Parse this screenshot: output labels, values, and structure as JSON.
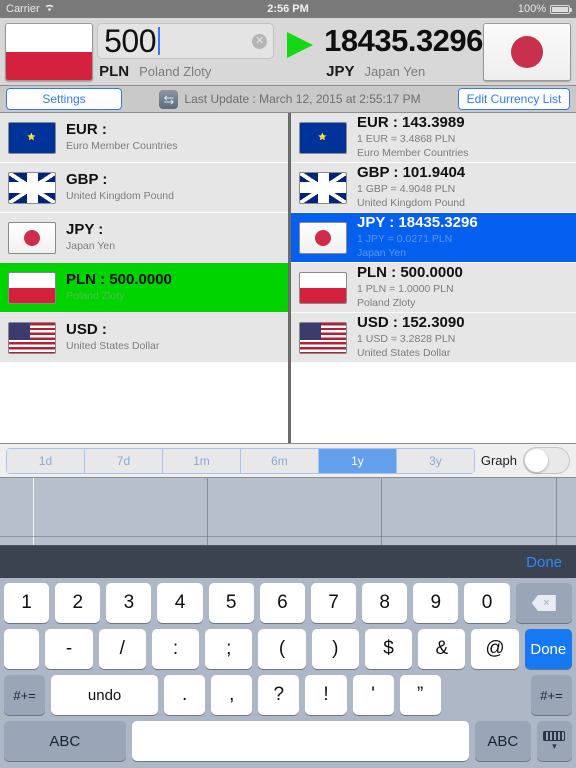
{
  "statusbar": {
    "carrier": "Carrier",
    "wifi_icon": "wifi-icon",
    "time": "2:56 PM",
    "battery_percent": "100%",
    "battery_icon": "battery-full-icon"
  },
  "header": {
    "source": {
      "flag_icon": "flag-poland-icon",
      "amount": "500",
      "code": "PLN",
      "name": "Poland Zloty",
      "clear_icon": "clear-icon"
    },
    "convert_icon": "play-triangle-icon",
    "target": {
      "result": "18435.3296",
      "code": "JPY",
      "name": "Japan Yen",
      "flag_icon": "flag-japan-icon"
    }
  },
  "toolbar": {
    "settings_label": "Settings",
    "refresh_icon": "refresh-icon",
    "last_update": "Last Update : March 12, 2015 at 2:55:17 PM",
    "edit_list_label": "Edit Currency List"
  },
  "left_list": [
    {
      "flag_icon": "flag-eu-icon",
      "flag_class": "f-eur",
      "title": "EUR :",
      "name": "Euro Member Countries",
      "state": ""
    },
    {
      "flag_icon": "flag-uk-icon",
      "flag_class": "f-gbp",
      "title": "GBP :",
      "name": "United Kingdom Pound",
      "state": ""
    },
    {
      "flag_icon": "flag-japan-icon",
      "flag_class": "f-jp",
      "title": "JPY :",
      "name": "Japan Yen",
      "state": ""
    },
    {
      "flag_icon": "flag-poland-icon",
      "flag_class": "f-pl",
      "title": "PLN : 500.0000",
      "name": "Poland Zloty",
      "state": "selected-green"
    },
    {
      "flag_icon": "flag-usa-icon",
      "flag_class": "f-usd",
      "title": "USD :",
      "name": "United States Dollar",
      "state": ""
    }
  ],
  "right_list": [
    {
      "flag_icon": "flag-eu-icon",
      "flag_class": "f-eur",
      "title": "EUR : 143.3989",
      "rate": "1 EUR = 3.4868 PLN",
      "name": "Euro Member Countries",
      "state": ""
    },
    {
      "flag_icon": "flag-uk-icon",
      "flag_class": "f-gbp",
      "title": "GBP : 101.9404",
      "rate": "1 GBP = 4.9048 PLN",
      "name": "United Kingdom Pound",
      "state": ""
    },
    {
      "flag_icon": "flag-japan-icon",
      "flag_class": "f-jp",
      "title": "JPY : 18435.3296",
      "rate": "1 JPY = 0.0271 PLN",
      "name": "Japan Yen",
      "state": "selected-blue"
    },
    {
      "flag_icon": "flag-poland-icon",
      "flag_class": "f-pl",
      "title": "PLN : 500.0000",
      "rate": "1 PLN = 1.0000 PLN",
      "name": "Poland Zloty",
      "state": ""
    },
    {
      "flag_icon": "flag-usa-icon",
      "flag_class": "f-usd",
      "title": "USD : 152.3090",
      "rate": "1 USD = 3.2828 PLN",
      "name": "United States Dollar",
      "state": ""
    }
  ],
  "range_selector": {
    "options": [
      "1d",
      "7d",
      "1m",
      "6m",
      "1y",
      "3y"
    ],
    "selected": "1y",
    "graph_label": "Graph",
    "graph_toggle_on": false
  },
  "keyboard": {
    "done_top_label": "Done",
    "row1": [
      "1",
      "2",
      "3",
      "4",
      "5",
      "6",
      "7",
      "8",
      "9",
      "0"
    ],
    "backspace_icon": "backspace-icon",
    "row2": [
      "-",
      "/",
      ":",
      ";",
      "(",
      ")",
      "$",
      "&",
      "@"
    ],
    "row2_done_label": "Done",
    "row3_left_label": "#+=",
    "row3_undo_label": "undo",
    "row3": [
      ".",
      ",",
      "?",
      "!",
      "'",
      "”"
    ],
    "row3_right_label": "#+=",
    "row4_abc_left": "ABC",
    "row4_space": "",
    "row4_abc_right": "ABC",
    "hide_keyboard_icon": "hide-keyboard-icon"
  },
  "colors": {
    "selected_green": "#00d400",
    "selected_blue": "#0560f0",
    "accent_blue": "#2f7bf6",
    "arrow_green": "#14d814"
  }
}
